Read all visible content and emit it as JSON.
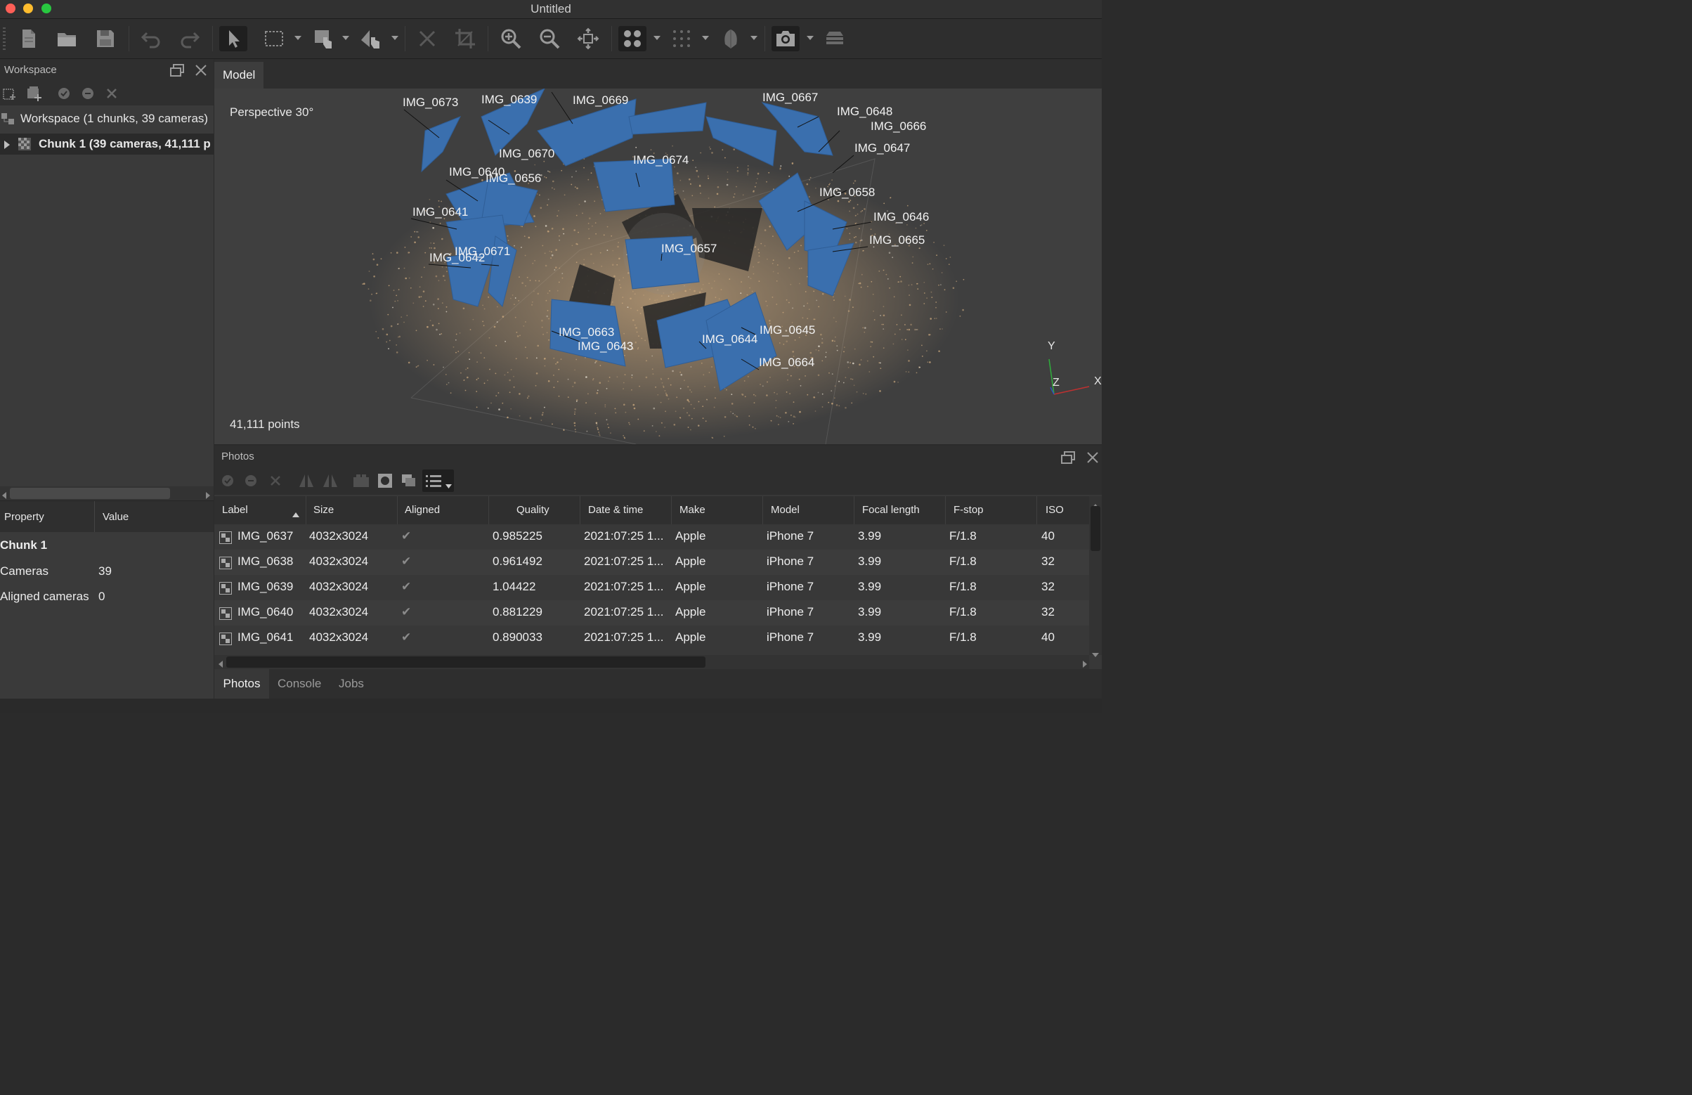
{
  "window": {
    "title": "Untitled"
  },
  "toolbar": {
    "icons": [
      "new-document-icon",
      "open-folder-icon",
      "save-icon",
      "undo-icon",
      "redo-icon",
      "pointer-icon",
      "rect-select-icon",
      "navigation-icon",
      "shape-icon",
      "delete-icon",
      "crop-icon",
      "zoom-in-icon",
      "zoom-out-icon",
      "reset-view-icon",
      "points-icon",
      "dense-points-icon",
      "model-icon",
      "camera-icon",
      "layers-icon"
    ]
  },
  "workspace": {
    "title": "Workspace",
    "tree": {
      "root": "Workspace (1 chunks, 39 cameras)",
      "chunk": "Chunk 1 (39 cameras, 41,111 p"
    }
  },
  "properties": {
    "headers": {
      "property": "Property",
      "value": "Value"
    },
    "group": "Chunk 1",
    "rows": [
      {
        "name": "Cameras",
        "value": "39"
      },
      {
        "name": "Aligned cameras",
        "value": "0"
      }
    ]
  },
  "model": {
    "tab": "Model",
    "projection": "Perspective 30°",
    "points": "41,111 points",
    "axes": {
      "y": "Y",
      "z": "Z",
      "x": "X"
    },
    "cameras": [
      "IMG_0673",
      "IMG_0639",
      "IMG_0669",
      "IMG_0667",
      "IMG_0648",
      "IMG_0666",
      "IMG_0647",
      "IMG_0670",
      "IMG_0674",
      "IMG_0640",
      "IMG_0656",
      "IMG_0658",
      "IMG_0641",
      "IMG_0646",
      "IMG_0665",
      "IMG_0671",
      "IMG_0642",
      "IMG_0657",
      "IMG_0663",
      "IMG_0643",
      "IMG_0644",
      "IMG_0645",
      "IMG_0664"
    ],
    "colors": {
      "camera": "#3a6fae",
      "cloud": "#c8a67c",
      "bg": "#3f3f3f"
    }
  },
  "photos": {
    "title": "Photos",
    "columns": [
      "Label",
      "Size",
      "Aligned",
      "Quality",
      "Date & time",
      "Make",
      "Model",
      "Focal length",
      "F-stop",
      "ISO"
    ],
    "rows": [
      {
        "label": "IMG_0637",
        "size": "4032x3024",
        "aligned": "✔",
        "quality": "0.985225",
        "date": "2021:07:25 1...",
        "make": "Apple",
        "model": "iPhone 7",
        "focal": "3.99",
        "fstop": "F/1.8",
        "iso": "40"
      },
      {
        "label": "IMG_0638",
        "size": "4032x3024",
        "aligned": "✔",
        "quality": "0.961492",
        "date": "2021:07:25 1...",
        "make": "Apple",
        "model": "iPhone 7",
        "focal": "3.99",
        "fstop": "F/1.8",
        "iso": "32"
      },
      {
        "label": "IMG_0639",
        "size": "4032x3024",
        "aligned": "✔",
        "quality": "1.04422",
        "date": "2021:07:25 1...",
        "make": "Apple",
        "model": "iPhone 7",
        "focal": "3.99",
        "fstop": "F/1.8",
        "iso": "32"
      },
      {
        "label": "IMG_0640",
        "size": "4032x3024",
        "aligned": "✔",
        "quality": "0.881229",
        "date": "2021:07:25 1...",
        "make": "Apple",
        "model": "iPhone 7",
        "focal": "3.99",
        "fstop": "F/1.8",
        "iso": "32"
      },
      {
        "label": "IMG_0641",
        "size": "4032x3024",
        "aligned": "✔",
        "quality": "0.890033",
        "date": "2021:07:25 1...",
        "make": "Apple",
        "model": "iPhone 7",
        "focal": "3.99",
        "fstop": "F/1.8",
        "iso": "40"
      }
    ]
  },
  "bottom_tabs": [
    "Photos",
    "Console",
    "Jobs"
  ]
}
